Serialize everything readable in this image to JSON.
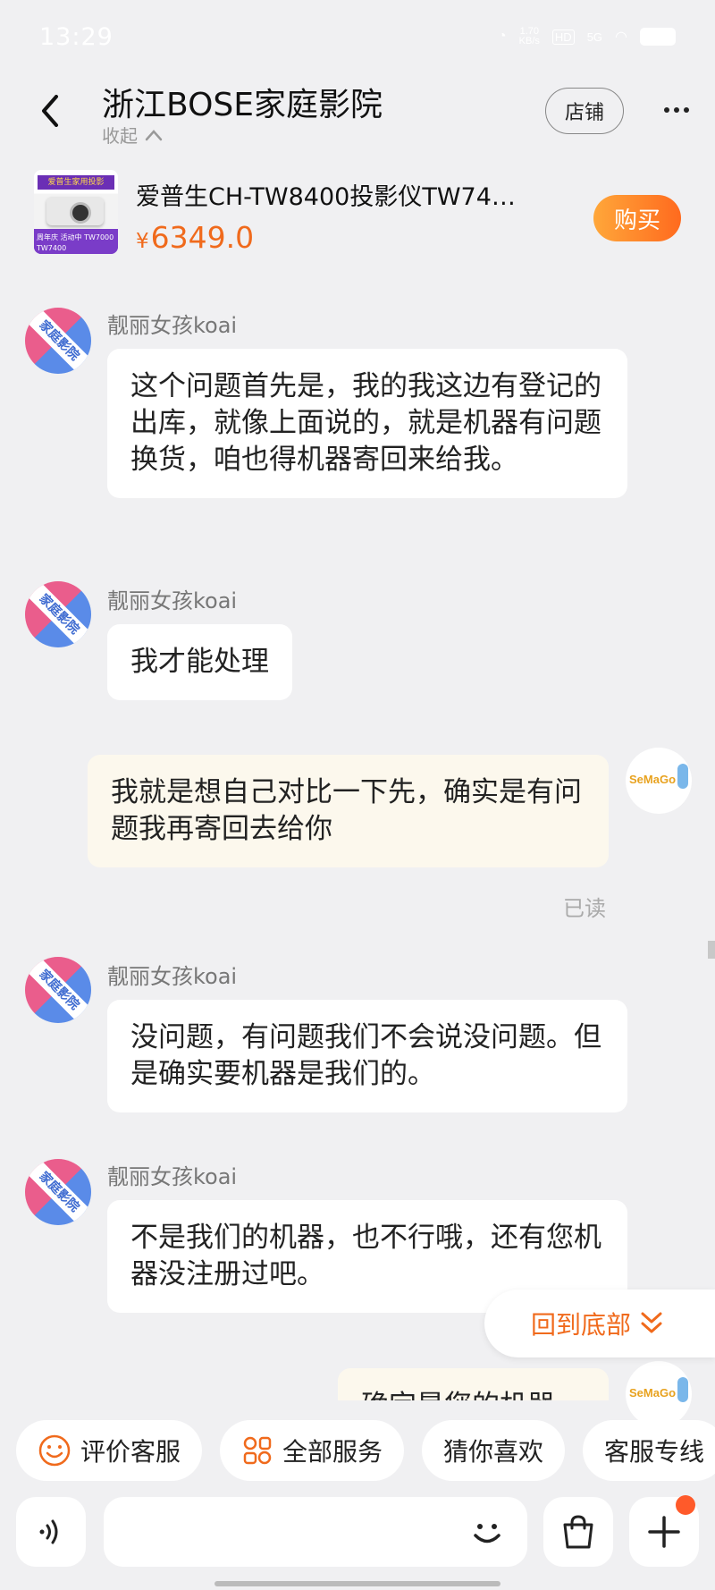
{
  "status_bar": {
    "time": "13:29",
    "net_speed_top": "1.70",
    "net_speed_bottom": "KB/s",
    "hd": "HD",
    "signal": "5G"
  },
  "header": {
    "title": "浙江BOSE家庭影院",
    "collapse_label": "收起",
    "store_button": "店铺"
  },
  "product": {
    "thumb_top_text": "爱普生家用投影",
    "thumb_bottom_text": "周年庆 活动中 TW7000 TW7400",
    "title": "爱普生CH-TW8400投影仪TW74…",
    "currency": "¥",
    "price": "6349.0",
    "buy_button": "购买"
  },
  "avatars": {
    "shop_label": "家庭影院",
    "me_label": "SeMaGo"
  },
  "messages": [
    {
      "side": "in",
      "sender": "靓丽女孩koai",
      "text": "这个问题首先是，我的我这边有登记的出库，就像上面说的，就是机器有问题换货，咱也得机器寄回来给我。"
    },
    {
      "side": "in",
      "sender": "靓丽女孩koai",
      "text": "我才能处理"
    },
    {
      "side": "out",
      "text": "我就是想自己对比一下先，确实是有问题我再寄回去给你",
      "status": "已读"
    },
    {
      "side": "in",
      "sender": "靓丽女孩koai",
      "text": "没问题，有问题我们不会说没问题。但是确实要机器是我们的。"
    },
    {
      "side": "in",
      "sender": "靓丽女孩koai",
      "text": "不是我们的机器，也不行哦，还有您机器没注册过吧。"
    },
    {
      "side": "out",
      "text": "确定是您的机器"
    }
  ],
  "back_to_bottom": "回到底部",
  "quick_replies": [
    {
      "label": "评价客服",
      "icon": "smile-icon"
    },
    {
      "label": "全部服务",
      "icon": "grid-icon"
    },
    {
      "label": "猜你喜欢",
      "icon": ""
    },
    {
      "label": "客服专线",
      "icon": ""
    }
  ],
  "input": {
    "placeholder": ""
  },
  "colors": {
    "accent": "#f06a1c",
    "bubble_out": "#fcf8ed",
    "bubble_in": "#ffffff",
    "background": "#f0f0f2"
  }
}
